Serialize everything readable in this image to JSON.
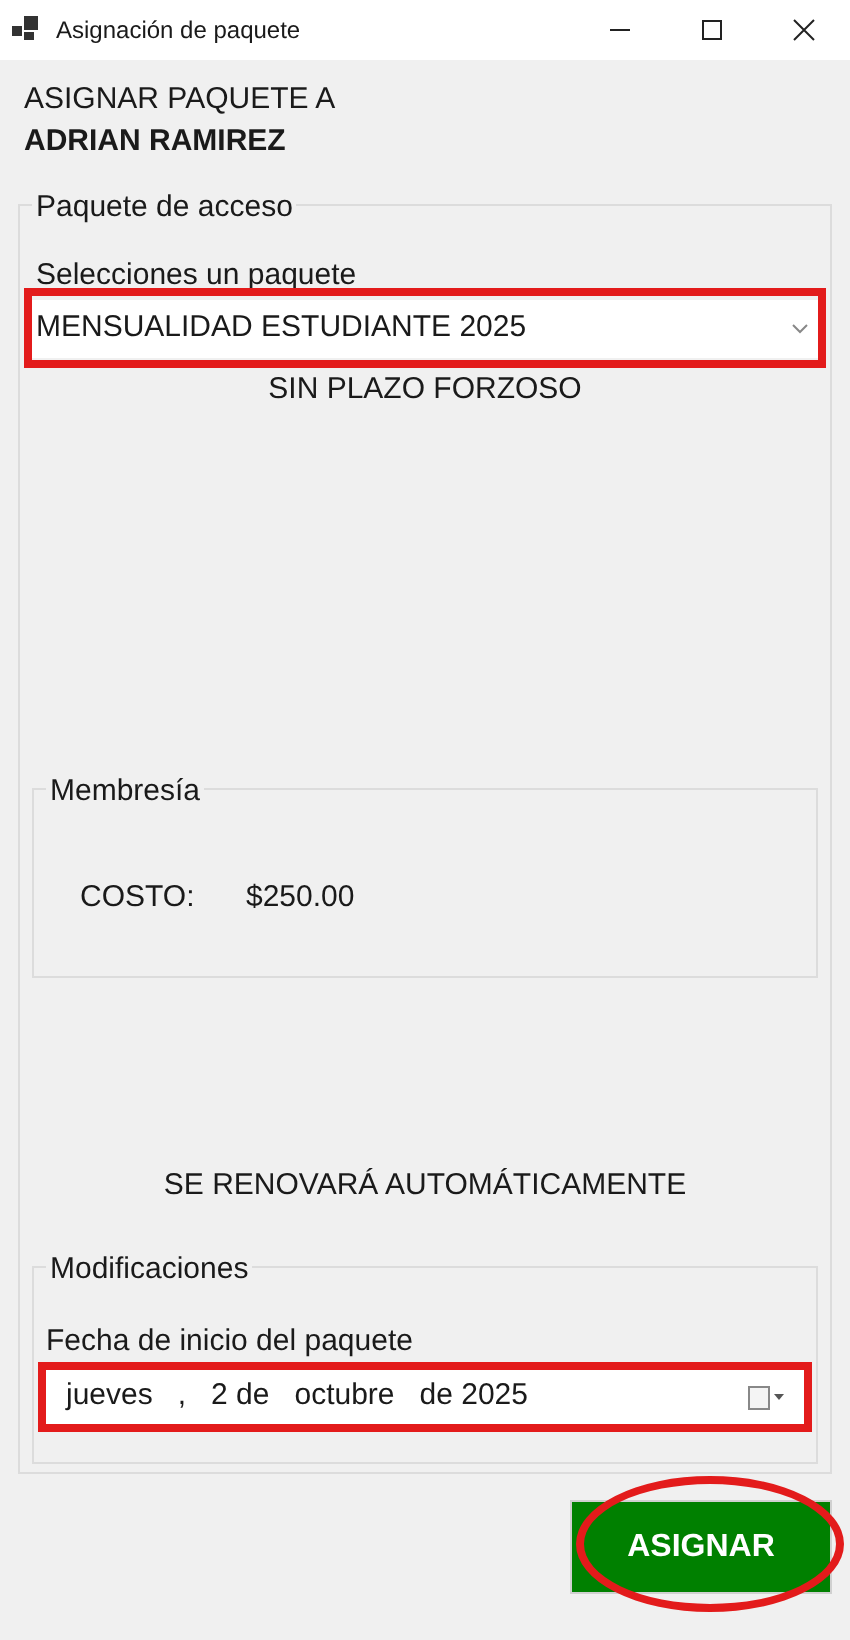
{
  "window": {
    "title": "Asignación de paquete"
  },
  "heading": {
    "line_1": "ASIGNAR PAQUETE A",
    "line_2": "ADRIAN RAMIREZ"
  },
  "access_group": {
    "legend": "Paquete de acceso",
    "package_label": "Selecciones un paquete",
    "package_value": "MENSUALIDAD ESTUDIANTE 2025",
    "package_highlighted": true,
    "term_note": "SIN PLAZO FORZOSO",
    "membership_group": {
      "legend": "Membresía",
      "cost_label": "COSTO:",
      "cost_value": "$250.00"
    },
    "renewal_note": "SE RENOVARÁ AUTOMÁTICAMENTE",
    "modifications_group": {
      "legend": "Modificaciones",
      "start_date_label": "Fecha de inicio del paquete",
      "start_date_parts": [
        "jueves",
        ",",
        "2 de",
        "octubre",
        "de 2025"
      ],
      "start_date_highlighted": true
    }
  },
  "assign_button": {
    "label": "ASIGNAR",
    "highlighted": true
  }
}
